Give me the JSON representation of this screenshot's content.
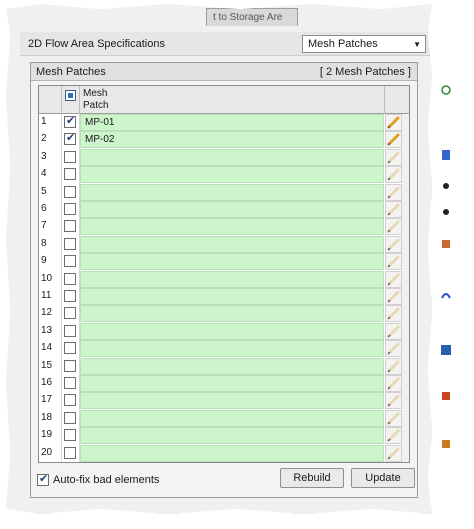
{
  "background_tab": {
    "label": "t to Storage Are"
  },
  "header": {
    "title": "2D Flow Area Specifications",
    "dropdown_value": "Mesh Patches"
  },
  "group": {
    "title": "Mesh Patches",
    "count": "[ 2 Mesh Patches ]"
  },
  "grid": {
    "col_mesh_line1": "Mesh",
    "col_mesh_line2": "Patch",
    "rows": [
      {
        "num": "1",
        "checked": true,
        "name": "MP-01"
      },
      {
        "num": "2",
        "checked": true,
        "name": "MP-02"
      },
      {
        "num": "3",
        "checked": false,
        "name": ""
      },
      {
        "num": "4",
        "checked": false,
        "name": ""
      },
      {
        "num": "5",
        "checked": false,
        "name": ""
      },
      {
        "num": "6",
        "checked": false,
        "name": ""
      },
      {
        "num": "7",
        "checked": false,
        "name": ""
      },
      {
        "num": "8",
        "checked": false,
        "name": ""
      },
      {
        "num": "9",
        "checked": false,
        "name": ""
      },
      {
        "num": "10",
        "checked": false,
        "name": ""
      },
      {
        "num": "11",
        "checked": false,
        "name": ""
      },
      {
        "num": "12",
        "checked": false,
        "name": ""
      },
      {
        "num": "13",
        "checked": false,
        "name": ""
      },
      {
        "num": "14",
        "checked": false,
        "name": ""
      },
      {
        "num": "15",
        "checked": false,
        "name": ""
      },
      {
        "num": "16",
        "checked": false,
        "name": ""
      },
      {
        "num": "17",
        "checked": false,
        "name": ""
      },
      {
        "num": "18",
        "checked": false,
        "name": ""
      },
      {
        "num": "19",
        "checked": false,
        "name": ""
      },
      {
        "num": "20",
        "checked": false,
        "name": ""
      }
    ]
  },
  "footer": {
    "auto_fix_label": "Auto-fix bad elements",
    "auto_fix_checked": true,
    "rebuild_label": "Rebuild",
    "update_label": "Update"
  },
  "colors": {
    "cell_green": "#ccf5cc",
    "pencil_active": "#e0a020",
    "pencil_inactive": "#e8d9b0"
  },
  "icons": {
    "edit": "pencil-icon",
    "checkbox_tick": "checkmark-icon"
  }
}
